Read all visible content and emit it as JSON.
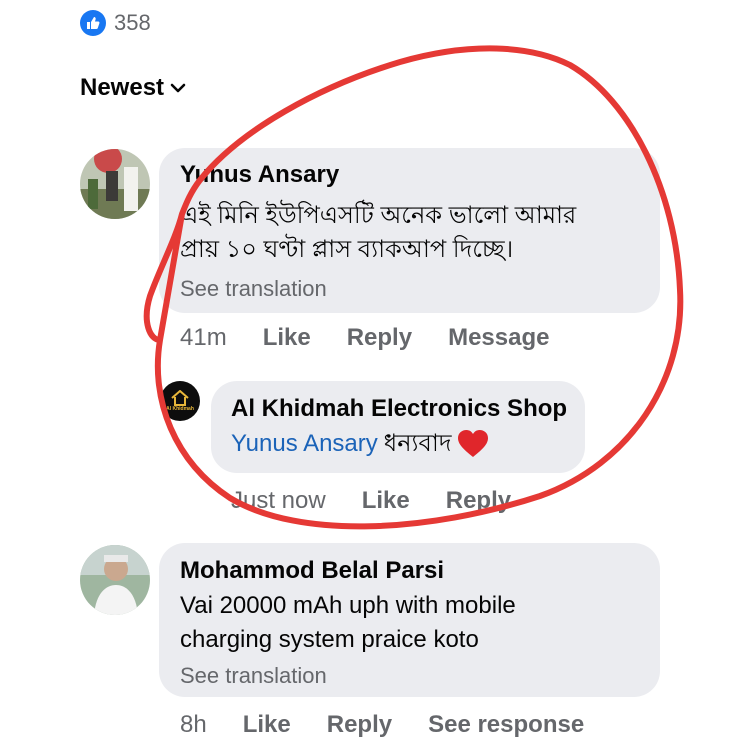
{
  "reactions": {
    "count": "358",
    "icon": "thumbs-up-icon",
    "color": "#1877f2"
  },
  "sort": {
    "label": "Newest",
    "icon": "chevron-down-icon"
  },
  "comments": [
    {
      "author": "Yunus Ansary",
      "text_line1": "এই মিনি ইউপিএসটি অনেক ভালো আমার",
      "text_line2": "প্রায় ১০ ঘণ্টা প্লাস ব্যাকআপ দিচ্ছে।",
      "see_translation": "See translation",
      "time": "41m",
      "like": "Like",
      "reply": "Reply",
      "message": "Message",
      "reply_item": {
        "author": "Al Khidmah Electronics Shop",
        "avatar_text": "Al Khidmah",
        "mention": "Yunus Ansary",
        "text": "ধন্যবাদ",
        "emoji": "❤️",
        "time": "Just now",
        "like": "Like",
        "reply": "Reply"
      }
    },
    {
      "author": "Mohammod Belal Parsi",
      "text_line1": "Vai 20000 mAh uph with mobile",
      "text_line2": "charging system praice koto",
      "see_translation": "See translation",
      "time": "8h",
      "like": "Like",
      "reply": "Reply",
      "see_response": "See response"
    }
  ],
  "colors": {
    "bubble": "#ebecf0",
    "meta": "#65676b",
    "mention": "#1b63b8",
    "annotation": "#e53935"
  }
}
